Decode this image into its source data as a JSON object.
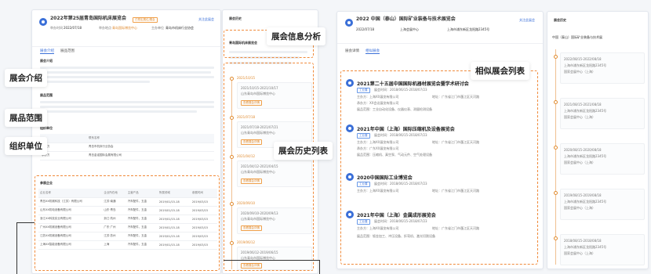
{
  "left": {
    "title": "2022年第25届青岛国际机床展览会",
    "badge": "已预定展位/展会",
    "follow": "关注此展会",
    "info_labels": [
      "举办时间",
      "举办地点",
      "主办单位"
    ],
    "info_values": [
      "2022/07/18",
      "青岛国际博览中心",
      "青岛市机床行业协会"
    ],
    "tabs": [
      "展会介绍",
      "展品范围"
    ],
    "intro_heading": "展会介绍",
    "scope_heading": "展品范围",
    "org_heading": "组织单位",
    "org_col": "联系名称",
    "org_rows": [
      {
        "role": "主办方",
        "name": "青岛市机床行业协会"
      },
      {
        "role": "承办方",
        "name": "青岛金诺国际会展有限公司"
      }
    ],
    "exhibitor_title": "参展企业",
    "table_headers": [
      "企业名称",
      "企业所在地",
      "主营产品",
      "所属领域",
      "参展时间"
    ],
    "table_rows": [
      [
        "青岛XX机械科技（江苏）有限公司",
        "江苏·南通",
        "汽车配件，五金",
        "2019/01/15-18",
        "2019/03/15"
      ],
      [
        "山东XX机电设备有限公司",
        "山东·青岛",
        "汽车配件，五金",
        "2019/01/15-18",
        "2019/03/15"
      ],
      [
        "浙江XX科技实业有限公司",
        "浙江·杭州",
        "汽车配件，五金",
        "2019/01/15-18",
        "2019/03/15"
      ],
      [
        "广州XX机械设备有限公司",
        "广东·广州",
        "汽车配件，五金",
        "2019/01/15-18",
        "2019/03/15"
      ],
      [
        "江苏XX机械设备有限公司",
        "江苏·苏州",
        "汽车配件，五金",
        "2019/01/15-18",
        "2019/03/15"
      ],
      [
        "上海XX智能设备有限公司",
        "上海",
        "汽车配件，五金",
        "2019/01/15-18",
        "2019/03/15"
      ]
    ]
  },
  "history": {
    "header": "展会历史",
    "subheader": "青岛国际机床展览会",
    "entries": [
      {
        "date": "2021/10/15",
        "time": "2021/10/15-2021/10/17",
        "venue": "山东青岛市国际博览中心",
        "btn": "查看展会详情"
      },
      {
        "date": "2021/07/18",
        "time": "2021/07/18-2021/07/21",
        "venue": "山东青岛市国际博览中心",
        "btn": "查看展会详情"
      },
      {
        "date": "2021/04/12",
        "time": "2021/04/12-2021/04/15",
        "venue": "山东青岛市国际博览中心",
        "btn": "查看展会详情"
      },
      {
        "date": "2020/09/10",
        "time": "2020/09/10-2020/09/13",
        "venue": "山东青岛市国际博览中心",
        "btn": "查看展会详情"
      },
      {
        "date": "2019/06/12",
        "time": "2019/06/12-2019/06/15",
        "venue": "山东青岛市国际博览中心",
        "btn": "查看展会详情"
      }
    ]
  },
  "right": {
    "title": "2022 中国（泰山）国际矿业装备与技术展览会",
    "follow": "关注此展会",
    "info_values": [
      "2022/07/18",
      "上海会展中心",
      "上海市浦东新区龙阳路2345号"
    ],
    "tabs": [
      "展会详情",
      "相似展会"
    ],
    "similar": [
      {
        "title": "2021第二十五届中国国际机器材展览会暨学术研讨会",
        "tag": "工业展",
        "date": "展会时间：2018/06/15-2018/07/23",
        "host": "主办方：上海XX展览有限公司",
        "addr": "地址：广东省江门市蓬江区天河路",
        "org": "承办方：XX会议展览有限公司",
        "desc": "展品范围：工业自动化设备、仪器仪表、测量检测设备"
      },
      {
        "title": "2021年中国（上海）国际压缩机及设备展览会",
        "tag": "工业展",
        "date": "展会时间：2018/06/15-2018/07/23",
        "host": "主办方：上海XX展览有限公司",
        "addr": "地址：广东省江门市蓬江区天河路",
        "org": "承办方：广东XX展览有限公司",
        "desc": "展品范围：压缩机、真空泵、气动元件、空气处理设备"
      },
      {
        "title": "2020中国国际工业博览会",
        "tag": "工业展",
        "date": "展会时间：2018/06/15-2018/07/23",
        "host": "主办方：上海XX展览有限公司",
        "addr": "地址：广东省江门市蓬江区天河路",
        "org": "",
        "desc": ""
      },
      {
        "title": "2021年中国（上海）金属成形展览会",
        "tag": "工业展",
        "date": "展会时间：2018/06/15-2018/07/23",
        "host": "主办方：上海XX展览有限公司",
        "addr": "地址：广东省江门市蓬江区天河路",
        "org": "",
        "desc": "展品范围：钣金加工、冲压设备、折弯机、激光切割设备"
      }
    ]
  },
  "right_history": {
    "header": "展会历史",
    "subheader": "中国（泰山）国际矿业装备与技术展",
    "entries": [
      {
        "time": "2022/08/15-2022/08/18",
        "venue": "上海市浦东新区龙阳路2345号",
        "hall": "国家会展中心（上海）"
      },
      {
        "time": "2021/08/15-2021/08/18",
        "venue": "上海市浦东新区龙阳路2345号",
        "hall": "国家会展中心（上海）"
      },
      {
        "time": "2020/08/15-2020/08/18",
        "venue": "上海市浦东新区龙阳路2345号",
        "hall": "国家会展中心（上海）"
      },
      {
        "time": "2019/08/15-2019/08/18",
        "venue": "上海市浦东新区龙阳路2345号",
        "hall": "国家会展中心（上海）"
      },
      {
        "time": "2018/08/15-2018/08/18",
        "venue": "上海市浦东新区龙阳路2345号",
        "hall": "国家会展中心（上海）"
      }
    ]
  },
  "callouts": {
    "intro": "展会介绍",
    "scope": "展品范围",
    "org": "组织单位",
    "analysis": "展会信息分析",
    "history_list": "展会历史列表",
    "similar_list": "相似展会列表"
  },
  "colors": {
    "accent": "#3a6fd8",
    "highlight": "#f08a3a"
  }
}
